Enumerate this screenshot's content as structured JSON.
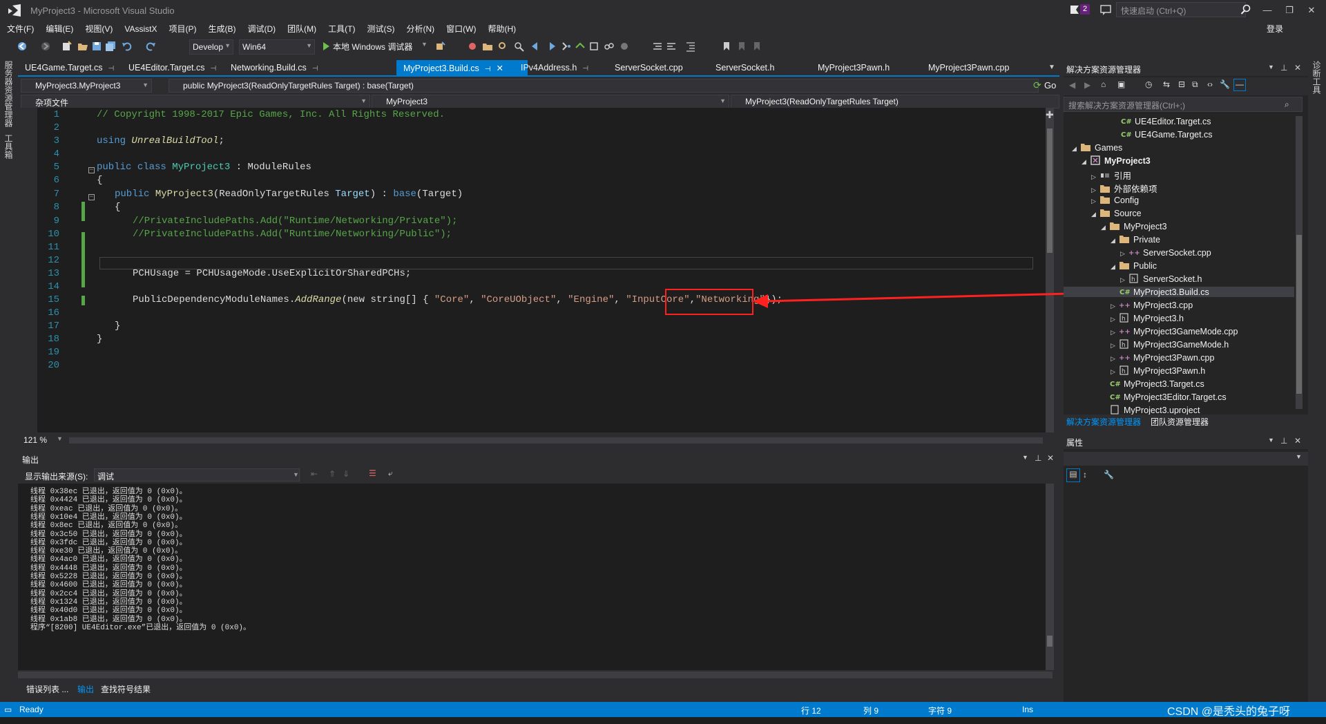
{
  "window": {
    "title": "MyProject3 - Microsoft Visual Studio",
    "notifications": "2",
    "quick_launch_placeholder": "快速启动 (Ctrl+Q)",
    "sign_in": "登录"
  },
  "menu": [
    "文件(F)",
    "编辑(E)",
    "视图(V)",
    "VAssistX",
    "项目(P)",
    "生成(B)",
    "调试(D)",
    "团队(M)",
    "工具(T)",
    "测试(S)",
    "分析(N)",
    "窗口(W)",
    "帮助(H)"
  ],
  "toolbar": {
    "config": "Develop",
    "platform": "Win64",
    "debugger": "本地 Windows 调试器"
  },
  "left_strip": [
    "服务器资源管理器",
    "工具箱"
  ],
  "right_strip": [
    "诊断工具"
  ],
  "doc_tabs": [
    {
      "label": "UE4Game.Target.cs",
      "active": false
    },
    {
      "label": "UE4Editor.Target.cs",
      "active": false
    },
    {
      "label": "Networking.Build.cs",
      "active": false
    },
    {
      "label": "MyProject3.Build.cs",
      "active": true
    },
    {
      "label": "IPv4Address.h",
      "active": false
    },
    {
      "label": "ServerSocket.cpp",
      "active": false
    },
    {
      "label": "ServerSocket.h",
      "active": false
    },
    {
      "label": "MyProject3Pawn.h",
      "active": false
    },
    {
      "label": "MyProject3Pawn.cpp",
      "active": false
    }
  ],
  "nav": {
    "class_combo": "MyProject3.MyProject3",
    "member_combo": "public MyProject3(ReadOnlyTargetRules Target) : base(Target)",
    "go_label": "Go",
    "scope_combo": "杂项文件",
    "project_combo": "MyProject3",
    "function_combo": "MyProject3(ReadOnlyTargetRules Target)"
  },
  "editor": {
    "line_numbers": [
      "1",
      "2",
      "3",
      "4",
      "5",
      "6",
      "7",
      "8",
      "9",
      "10",
      "11",
      "12",
      "13",
      "14",
      "15",
      "16",
      "17",
      "18",
      "19",
      "20"
    ],
    "copyright": "// Copyright 1998-2017 Epic Games, Inc. All Rights Reserved.",
    "using_kw": "using",
    "using_ns": "UnrealBuildTool",
    "using_semi": ";",
    "class_pub": "public",
    "class_kw": "class",
    "class_name": "MyProject3",
    "class_rest": " : ModuleRules",
    "brace_open": "{",
    "ctor_pub": "public",
    "ctor_name": "MyProject3",
    "ctor_args1": "(ReadOnlyTargetRules ",
    "ctor_target": "Target",
    "ctor_args2": ") : ",
    "ctor_base": "base",
    "ctor_args3": "(Target)",
    "inner_brace_open": "{",
    "comment_private": "//PrivateIncludePaths.Add(\"Runtime/Networking/Private\");",
    "comment_public": "//PrivateIncludePaths.Add(\"Runtime/Networking/Public\");",
    "pch_line": "PCHUsage = PCHUsageMode.UseExplicitOrSharedPCHs;",
    "dep_prefix": "PublicDependencyModuleNames.",
    "dep_method": "AddRange",
    "dep_new": "(new string[] { ",
    "dep_core": "\"Core\"",
    "dep_coreuobject": "\"CoreUObject\"",
    "dep_engine": "\"Engine\"",
    "dep_inputcore": "\"InputCore\"",
    "dep_networking": "\"Networking\"",
    "dep_comma": ", ",
    "dep_end": "});",
    "inner_brace_close": "}",
    "brace_close": "}",
    "zoom": "121 %"
  },
  "solution_explorer": {
    "title": "解决方案资源管理器",
    "search_placeholder": "搜索解决方案资源管理器(Ctrl+;)",
    "items": [
      {
        "label": "UE4Editor.Target.cs",
        "icon": "csharp-icon",
        "expand": ""
      },
      {
        "label": "UE4Game.Target.cs",
        "icon": "csharp-icon",
        "expand": ""
      },
      {
        "label": "Games",
        "icon": "folder-icon",
        "expand": "◢"
      },
      {
        "label": "MyProject3",
        "icon": "project-icon",
        "expand": "◢"
      },
      {
        "label": "引用",
        "icon": "references-icon",
        "expand": "▷"
      },
      {
        "label": "外部依赖项",
        "icon": "folder-icon",
        "expand": "▷"
      },
      {
        "label": "Config",
        "icon": "folder-icon",
        "expand": "▷"
      },
      {
        "label": "Source",
        "icon": "folder-icon",
        "expand": "◢"
      },
      {
        "label": "MyProject3",
        "icon": "folder-icon",
        "expand": "◢"
      },
      {
        "label": "Private",
        "icon": "folder-icon",
        "expand": "◢"
      },
      {
        "label": "ServerSocket.cpp",
        "icon": "cpp-icon",
        "expand": "▷"
      },
      {
        "label": "Public",
        "icon": "folder-icon",
        "expand": "◢"
      },
      {
        "label": "ServerSocket.h",
        "icon": "header-icon",
        "expand": "▷"
      },
      {
        "label": "MyProject3.Build.cs",
        "icon": "csharp-icon",
        "expand": ""
      },
      {
        "label": "MyProject3.cpp",
        "icon": "cpp-icon",
        "expand": "▷"
      },
      {
        "label": "MyProject3.h",
        "icon": "header-icon",
        "expand": "▷"
      },
      {
        "label": "MyProject3GameMode.cpp",
        "icon": "cpp-icon",
        "expand": "▷"
      },
      {
        "label": "MyProject3GameMode.h",
        "icon": "header-icon",
        "expand": "▷"
      },
      {
        "label": "MyProject3Pawn.cpp",
        "icon": "cpp-icon",
        "expand": "▷"
      },
      {
        "label": "MyProject3Pawn.h",
        "icon": "header-icon",
        "expand": "▷"
      },
      {
        "label": "MyProject3.Target.cs",
        "icon": "csharp-icon",
        "expand": ""
      },
      {
        "label": "MyProject3Editor.Target.cs",
        "icon": "csharp-icon",
        "expand": ""
      },
      {
        "label": "MyProject3.uproject",
        "icon": "file-icon",
        "expand": ""
      }
    ],
    "tab_solution": "解决方案资源管理器",
    "tab_team": "团队资源管理器"
  },
  "properties": {
    "title": "属性"
  },
  "output": {
    "title": "输出",
    "source_label": "显示输出来源(S):",
    "source_value": "调试",
    "lines": [
      "线程 0x38ec 已退出，返回值为 0 (0x0)。",
      "线程 0x4424 已退出，返回值为 0 (0x0)。",
      "线程 0xeac 已退出，返回值为 0 (0x0)。",
      "线程 0x10e4 已退出，返回值为 0 (0x0)。",
      "线程 0x8ec 已退出，返回值为 0 (0x0)。",
      "线程 0x3c50 已退出，返回值为 0 (0x0)。",
      "线程 0x3fdc 已退出，返回值为 0 (0x0)。",
      "线程 0xe30 已退出，返回值为 0 (0x0)。",
      "线程 0x4ac0 已退出，返回值为 0 (0x0)。",
      "线程 0x4448 已退出，返回值为 0 (0x0)。",
      "线程 0x5228 已退出，返回值为 0 (0x0)。",
      "线程 0x4600 已退出，返回值为 0 (0x0)。",
      "线程 0x2cc4 已退出，返回值为 0 (0x0)。",
      "线程 0x1324 已退出，返回值为 0 (0x0)。",
      "线程 0x40d0 已退出，返回值为 0 (0x0)。",
      "线程 0x1ab8 已退出，返回值为 0 (0x0)。",
      "程序“[8200] UE4Editor.exe”已退出，返回值为 0 (0x0)。"
    ]
  },
  "bottom_tabs": [
    "错误列表 ...",
    "输出",
    "查找符号结果"
  ],
  "status": {
    "ready": "Ready",
    "line": "行 12",
    "col": "列 9",
    "char": "字符 9",
    "mode": "Ins",
    "watermark": "CSDN @是秃头的兔子呀"
  },
  "colors": {
    "accent": "#007acc",
    "highlight": "#ff2020"
  }
}
